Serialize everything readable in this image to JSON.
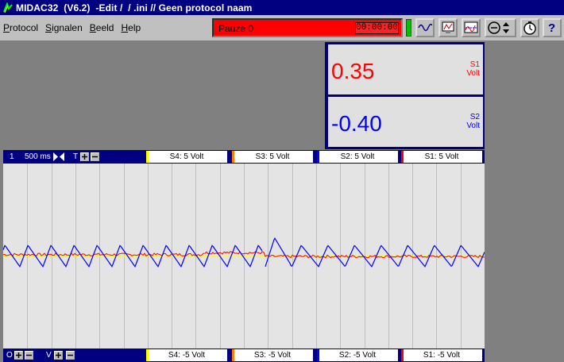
{
  "window": {
    "title": "MIDAC32  (V6.2)  -Edit /  / .ini // Geen protocol naam"
  },
  "menu": {
    "items": [
      {
        "label": "Protocol",
        "accel": "P"
      },
      {
        "label": "Signalen",
        "accel": "S"
      },
      {
        "label": "Beeld",
        "accel": "B"
      },
      {
        "label": "Help",
        "accel": "H"
      }
    ]
  },
  "status": {
    "text": "Pauze 0",
    "timer": "00:00:00",
    "color": "#ff0000",
    "indicator_color": "#00c000"
  },
  "toolbar_buttons": [
    "waveform-icon",
    "monitor-icon",
    "chart-icon",
    "zoom-icon",
    "stopwatch-icon",
    "help-icon"
  ],
  "readouts": [
    {
      "value": "0.35",
      "channel": "S1",
      "unit": "Volt",
      "color": "#ff0000"
    },
    {
      "value": "-0.40",
      "channel": "S2",
      "unit": "Volt",
      "color": "#0000ff"
    }
  ],
  "top_bar": {
    "page_number": "1",
    "timebase": "500 ms",
    "trigger_label": "T",
    "channels": [
      {
        "label": "S4: 5 Volt",
        "color": "#ffff00"
      },
      {
        "label": "S3: 5 Volt",
        "color": "#ff8000"
      },
      {
        "label": "S2: 5 Volt",
        "color": "#0000ff"
      },
      {
        "label": "S1: 5 Volt",
        "color": "#ff0000"
      }
    ]
  },
  "bottom_bar": {
    "offset_label": "O",
    "volt_label": "V",
    "channels": [
      {
        "label": "S4: -5 Volt",
        "color": "#ffff00"
      },
      {
        "label": "S3: -5 Volt",
        "color": "#ff8000"
      },
      {
        "label": "S2: -5 Volt",
        "color": "#0000ff"
      },
      {
        "label": "S1: -5 Volt",
        "color": "#ff0000"
      }
    ]
  },
  "chart_data": {
    "type": "line",
    "grid": true,
    "xlim": [
      0,
      5
    ],
    "ylim": [
      -5,
      5
    ],
    "x_divisions": 20,
    "series": [
      {
        "name": "S1",
        "color": "#ff0000",
        "values_description_free": true
      },
      {
        "name": "S2",
        "color": "#0000ff",
        "values_description_free": true
      },
      {
        "name": "S4",
        "color": "#ffff00",
        "values_description_free": true
      }
    ]
  }
}
